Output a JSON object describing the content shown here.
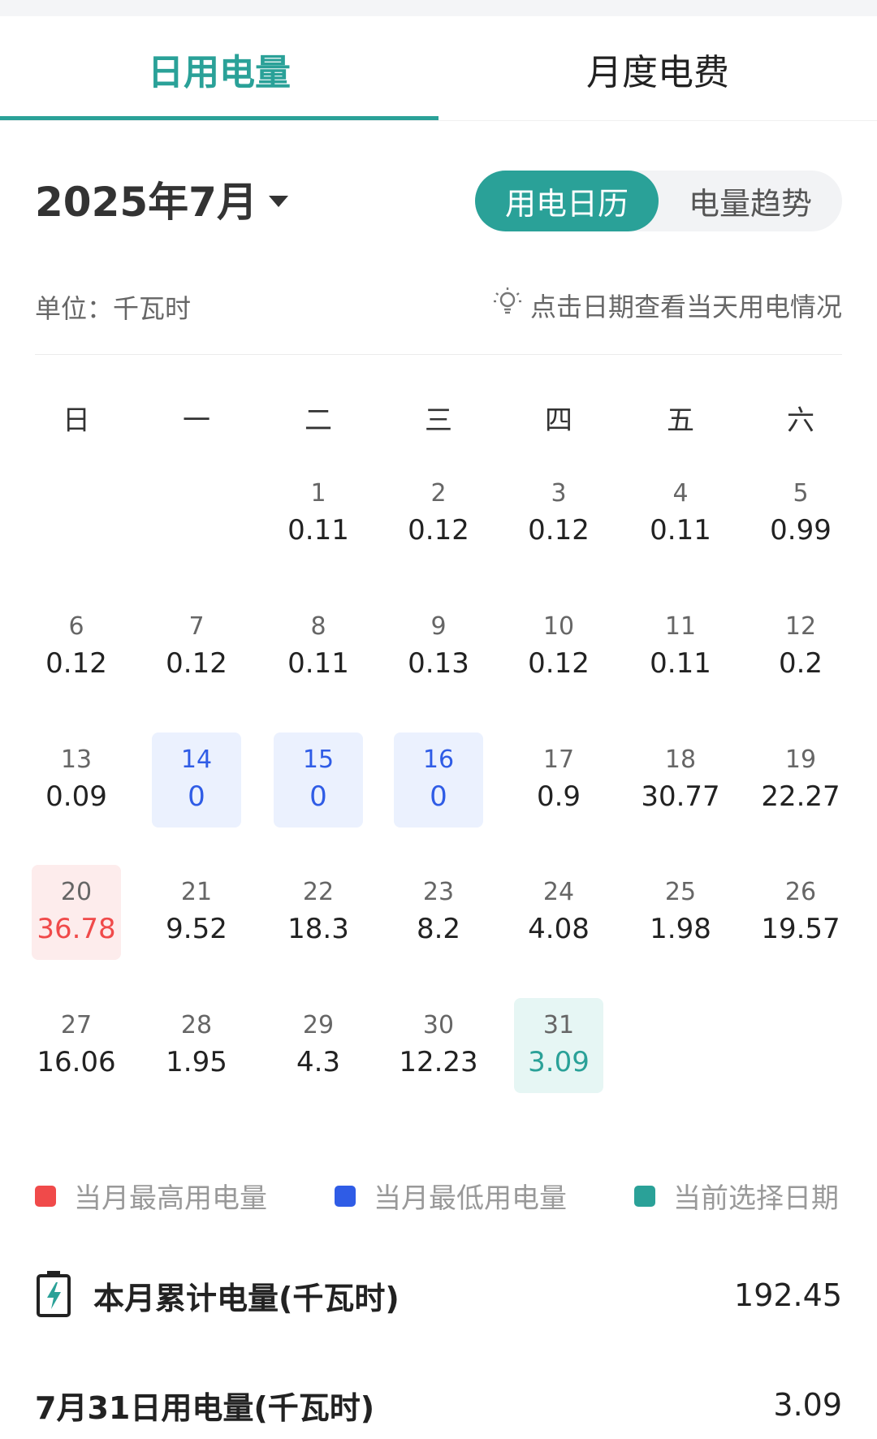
{
  "tabs": [
    {
      "label": "日用电量",
      "active": true
    },
    {
      "label": "月度电费",
      "active": false
    }
  ],
  "month_selector": {
    "label": "2025年7月"
  },
  "view_toggle": {
    "options": [
      {
        "label": "用电日历",
        "active": true
      },
      {
        "label": "电量趋势",
        "active": false
      }
    ]
  },
  "unit_label": "单位：千瓦时",
  "tip_text": "点击日期查看当天用电情况",
  "weekdays": [
    "日",
    "一",
    "二",
    "三",
    "四",
    "五",
    "六"
  ],
  "calendar": {
    "first_weekday_index": 2,
    "days": [
      {
        "day": "1",
        "value": "0.11"
      },
      {
        "day": "2",
        "value": "0.12"
      },
      {
        "day": "3",
        "value": "0.12"
      },
      {
        "day": "4",
        "value": "0.11"
      },
      {
        "day": "5",
        "value": "0.99"
      },
      {
        "day": "6",
        "value": "0.12"
      },
      {
        "day": "7",
        "value": "0.12"
      },
      {
        "day": "8",
        "value": "0.11"
      },
      {
        "day": "9",
        "value": "0.13"
      },
      {
        "day": "10",
        "value": "0.12"
      },
      {
        "day": "11",
        "value": "0.11"
      },
      {
        "day": "12",
        "value": "0.2"
      },
      {
        "day": "13",
        "value": "0.09"
      },
      {
        "day": "14",
        "value": "0",
        "status": "low"
      },
      {
        "day": "15",
        "value": "0",
        "status": "low"
      },
      {
        "day": "16",
        "value": "0",
        "status": "low"
      },
      {
        "day": "17",
        "value": "0.9"
      },
      {
        "day": "18",
        "value": "30.77"
      },
      {
        "day": "19",
        "value": "22.27"
      },
      {
        "day": "20",
        "value": "36.78",
        "status": "high"
      },
      {
        "day": "21",
        "value": "9.52"
      },
      {
        "day": "22",
        "value": "18.3"
      },
      {
        "day": "23",
        "value": "8.2"
      },
      {
        "day": "24",
        "value": "4.08"
      },
      {
        "day": "25",
        "value": "1.98"
      },
      {
        "day": "26",
        "value": "19.57"
      },
      {
        "day": "27",
        "value": "16.06"
      },
      {
        "day": "28",
        "value": "1.95"
      },
      {
        "day": "29",
        "value": "4.3"
      },
      {
        "day": "30",
        "value": "12.23"
      },
      {
        "day": "31",
        "value": "3.09",
        "status": "selected"
      }
    ]
  },
  "legend": [
    {
      "label": "当月最高用电量",
      "color": "#f04a4a"
    },
    {
      "label": "当月最低用电量",
      "color": "#2f5ce6"
    },
    {
      "label": "当前选择日期",
      "color": "#2aa198"
    }
  ],
  "summary": {
    "label": "本月累计电量(千瓦时)",
    "value": "192.45",
    "icon": "battery-charging-icon"
  },
  "selected_day_usage": {
    "label": "7月31日用电量(千瓦时)",
    "value": "3.09"
  },
  "colors": {
    "accent": "#2aa198",
    "high": "#f04a4a",
    "low": "#2f5ce6"
  }
}
